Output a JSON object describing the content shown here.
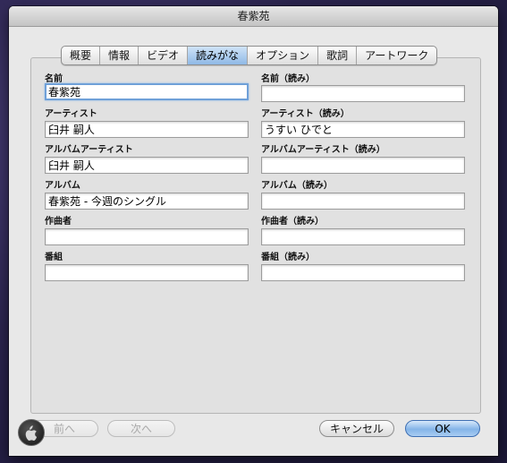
{
  "window": {
    "title": "春紫苑"
  },
  "tabs": [
    {
      "label": "概要",
      "active": false
    },
    {
      "label": "情報",
      "active": false
    },
    {
      "label": "ビデオ",
      "active": false
    },
    {
      "label": "読みがな",
      "active": true
    },
    {
      "label": "オプション",
      "active": false
    },
    {
      "label": "歌詞",
      "active": false
    },
    {
      "label": "アートワーク",
      "active": false
    }
  ],
  "fields": {
    "name": {
      "label": "名前",
      "value": "春紫苑"
    },
    "name_reading": {
      "label": "名前（読み）",
      "value": ""
    },
    "artist": {
      "label": "アーティスト",
      "value": "臼井 嗣人"
    },
    "artist_reading": {
      "label": "アーティスト（読み）",
      "value": "うすい ひでと"
    },
    "album_artist": {
      "label": "アルバムアーティスト",
      "value": "臼井 嗣人"
    },
    "album_artist_reading": {
      "label": "アルバムアーティスト（読み）",
      "value": ""
    },
    "album": {
      "label": "アルバム",
      "value": "春紫苑 - 今週のシングル"
    },
    "album_reading": {
      "label": "アルバム（読み）",
      "value": ""
    },
    "composer": {
      "label": "作曲者",
      "value": ""
    },
    "composer_reading": {
      "label": "作曲者（読み）",
      "value": ""
    },
    "show": {
      "label": "番組",
      "value": ""
    },
    "show_reading": {
      "label": "番組（読み）",
      "value": ""
    }
  },
  "buttons": {
    "prev": "前へ",
    "next": "次へ",
    "cancel": "キャンセル",
    "ok": "OK"
  },
  "colors": {
    "accent": "#8fb9e6",
    "focus_ring": "#6fa0d8",
    "default_button": "#84b4e8"
  },
  "icons": {
    "badge": "apple-logo-icon"
  }
}
